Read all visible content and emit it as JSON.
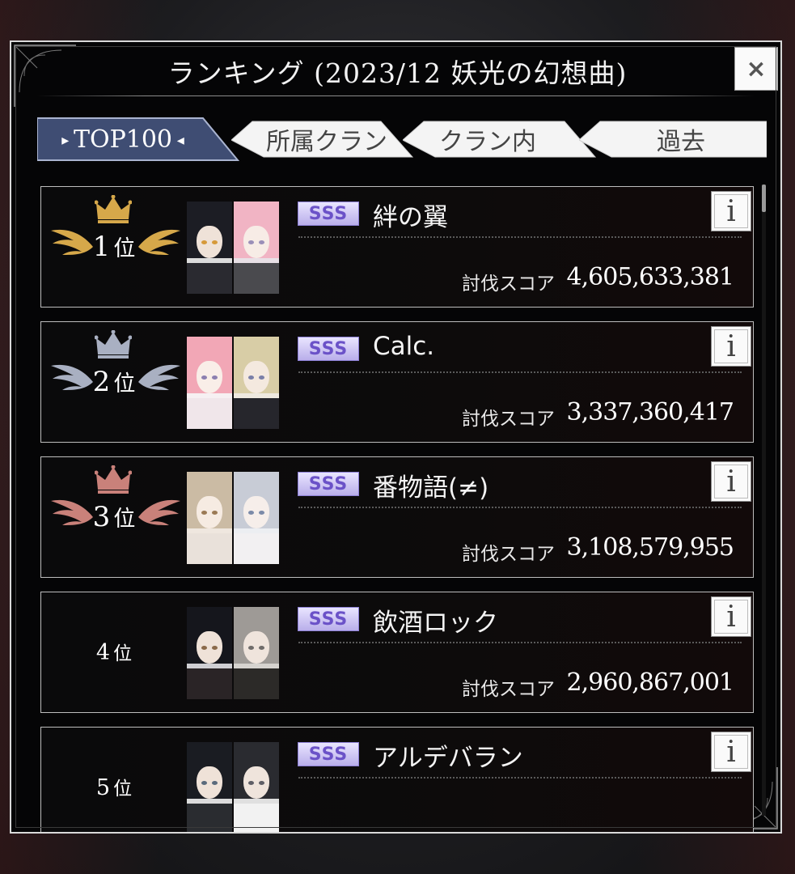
{
  "dialog": {
    "title": "ランキング (2023/12 妖光の幻想曲)",
    "close_label": "×"
  },
  "tabs": [
    {
      "label": "TOP100",
      "active": true
    },
    {
      "label": "所属クラン",
      "active": false
    },
    {
      "label": "クラン内",
      "active": false
    },
    {
      "label": "過去",
      "active": false
    }
  ],
  "entries": [
    {
      "rank_number": "1",
      "rank_suffix": "位",
      "tier": "SSS",
      "name": "絆の翼",
      "score_label": "討伐スコア",
      "score": "4,605,633,381",
      "crown_color": "#d6a84a"
    },
    {
      "rank_number": "2",
      "rank_suffix": "位",
      "tier": "SSS",
      "name": "Calc.",
      "score_label": "討伐スコア",
      "score": "3,337,360,417",
      "crown_color": "#a9b0c2"
    },
    {
      "rank_number": "3",
      "rank_suffix": "位",
      "tier": "SSS",
      "name": "番物語(≠)",
      "score_label": "討伐スコア",
      "score": "3,108,579,955",
      "crown_color": "#c9817a"
    },
    {
      "rank_number": "4",
      "rank_suffix": "位",
      "tier": "SSS",
      "name": "飲酒ロック",
      "score_label": "討伐スコア",
      "score": "2,960,867,001"
    },
    {
      "rank_number": "5",
      "rank_suffix": "位",
      "tier": "SSS",
      "name": "アルデバラン"
    }
  ],
  "info_label": "i",
  "colors": {
    "accent_tab": "#3f4d73",
    "gold": "#d6a84a",
    "silver": "#a9b0c2",
    "bronze": "#c9817a",
    "tier_badge": "#6b52c8"
  }
}
